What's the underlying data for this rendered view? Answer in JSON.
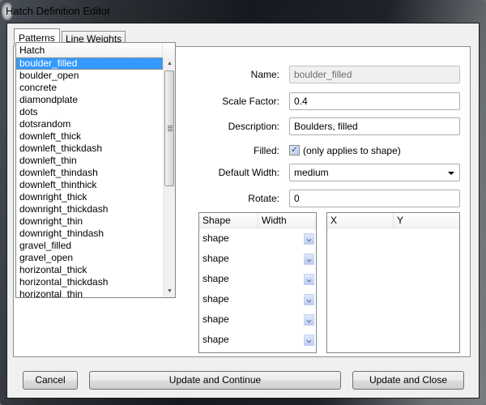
{
  "window": {
    "title": "Hatch Definition Editor"
  },
  "tabs": [
    {
      "label": "Patterns",
      "active": true
    },
    {
      "label": "Line Weights",
      "active": false
    }
  ],
  "hatch_list": {
    "header": "Hatch",
    "items": [
      "boulder_filled",
      "boulder_open",
      "concrete",
      "diamondplate",
      "dots",
      "dotsrandom",
      "downleft_thick",
      "downleft_thickdash",
      "downleft_thin",
      "downleft_thindash",
      "downleft_thinthick",
      "downright_thick",
      "downright_thickdash",
      "downright_thin",
      "downright_thindash",
      "gravel_filled",
      "gravel_open",
      "horizontal_thick",
      "horizontal_thickdash",
      "horizontal_thin"
    ],
    "selected": "boulder_filled"
  },
  "form": {
    "name_label": "Name:",
    "name_value": "boulder_filled",
    "scale_label": "Scale Factor:",
    "scale_value": "0.4",
    "description_label": "Description:",
    "description_value": "Boulders, filled",
    "filled_label": "Filled:",
    "filled_checked": true,
    "filled_check_glyph": "✓",
    "filled_note": "(only applies to shape)",
    "default_width_label": "Default Width:",
    "default_width_value": "medium",
    "rotate_label": "Rotate:",
    "rotate_value": "0"
  },
  "shape_grid": {
    "columns": [
      "Shape",
      "Width"
    ],
    "rows": [
      "shape",
      "shape",
      "shape",
      "shape",
      "shape",
      "shape"
    ]
  },
  "xy_grid": {
    "columns": [
      "X",
      "Y"
    ],
    "rows": []
  },
  "buttons": {
    "cancel": "Cancel",
    "update_continue": "Update and Continue",
    "update_close": "Update and Close"
  },
  "scroll_icons": {
    "up": "▲",
    "down": "▼"
  }
}
